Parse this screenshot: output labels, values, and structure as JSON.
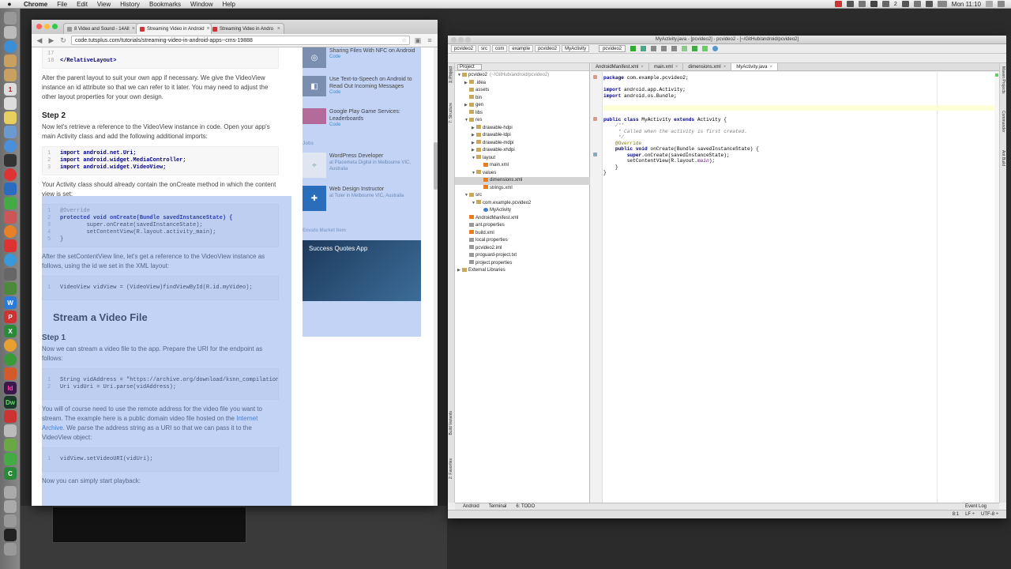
{
  "menubar": {
    "apple": "",
    "app": "Chrome",
    "items": [
      "File",
      "Edit",
      "View",
      "History",
      "Bookmarks",
      "Window",
      "Help"
    ],
    "clock": "Mon 11:10",
    "battery": "2"
  },
  "chrome": {
    "tabs": [
      {
        "label": "8 Video and Sound - 14All",
        "close": "×"
      },
      {
        "label": "Streaming Video in Android",
        "close": "×"
      },
      {
        "label": "Streaming Video in Andro",
        "close": "×"
      }
    ],
    "url": "code.tutsplus.com/tutorials/streaming-video-in-android-apps--cms-19888",
    "article": {
      "code0_line17": "17",
      "code0_line18": "18",
      "code0_text": "</RelativeLayout>",
      "p1": "Alter the parent layout to suit your own app if necessary. We give the VideoView instance an id attribute so that we can refer to it later. You may need to adjust the other layout properties for your own design.",
      "step2": "Step 2",
      "p2": "Now let's retrieve a reference to the VideoView instance in code. Open your app's main Activity class and add the following additional imports:",
      "imports": [
        "import android.net.Uri;",
        "import android.widget.MediaController;",
        "import android.widget.VideoView;"
      ],
      "p3": "Your Activity class should already contain the onCreate method in which the content view is set:",
      "oncreate": [
        "@Override",
        "protected void onCreate(Bundle savedInstanceState) {",
        "        super.onCreate(savedInstanceState);",
        "        setContentView(R.layout.activity_main);",
        "}"
      ],
      "p4": "After the setContentView line, let's get a reference to the VideoView instance as follows, using the id we set in the XML layout:",
      "findview": "VideoView vidView = (VideoView)findViewById(R.id.myVideo);",
      "h_stream": "Stream a Video File",
      "step1": "Step 1",
      "p5": "Now we can stream a video file to the app. Prepare the URI for the endpoint as follows:",
      "uri_lines": [
        "String vidAddress = \"https://archive.org/download/ksnn_compilation",
        "Uri vidUri = Uri.parse(vidAddress);"
      ],
      "p6a": "You will of course need to use the remote address for the video file you want to stream. The example here is a public domain video file hosted on the ",
      "p6link": "Internet Archive",
      "p6b": ". We parse the address string as a URI so that we can pass it to the VideoView object:",
      "seturi": "vidView.setVideoURI(vidUri);",
      "p7": "Now you can simply start playback:"
    },
    "sidebar": {
      "items": [
        {
          "title": "Sharing Files With NFC on Android",
          "tag": "Code"
        },
        {
          "title": "Use Text-to-Speech on Android to Read Out Incoming Messages",
          "tag": "Code"
        },
        {
          "title": "Google Play Game Services: Leaderboards",
          "tag": "Code"
        }
      ],
      "jobs_head": "Jobs",
      "jobs": [
        {
          "title": "WordPress Developer",
          "sub": "at Placemeta Digital in Melbourne VIC, Australia"
        },
        {
          "title": "Web Design Instructor",
          "sub": "at Tuler in Melbourne VIC, Australia"
        }
      ],
      "market_head": "Envato Market Item",
      "market_title": "Success Quotes App"
    }
  },
  "ide": {
    "title": "MyActivity.java - [pcvideo2] - pcvideo2 - [~/GitHub/android/pcvideo2]",
    "breadcrumbs": [
      "pcvideo2",
      "src",
      "com",
      "example",
      "pcvideo2",
      "MyActivity"
    ],
    "run_config": "pcvideo2",
    "project_select": "Project",
    "tree": [
      {
        "label": "pcvideo2",
        "sub": "(~/GitHub/android/pcvideo2)",
        "indent": 0,
        "arrow": "▼",
        "icon": "folder"
      },
      {
        "label": ".idea",
        "indent": 1,
        "arrow": "▶",
        "icon": "folder"
      },
      {
        "label": "assets",
        "indent": 1,
        "arrow": "",
        "icon": "folder"
      },
      {
        "label": "bin",
        "indent": 1,
        "arrow": "",
        "icon": "folder"
      },
      {
        "label": "gen",
        "indent": 1,
        "arrow": "▶",
        "icon": "folder"
      },
      {
        "label": "libs",
        "indent": 1,
        "arrow": "",
        "icon": "folder"
      },
      {
        "label": "res",
        "indent": 1,
        "arrow": "▼",
        "icon": "folder"
      },
      {
        "label": "drawable-hdpi",
        "indent": 2,
        "arrow": "▶",
        "icon": "folder"
      },
      {
        "label": "drawable-ldpi",
        "indent": 2,
        "arrow": "▶",
        "icon": "folder"
      },
      {
        "label": "drawable-mdpi",
        "indent": 2,
        "arrow": "▶",
        "icon": "folder"
      },
      {
        "label": "drawable-xhdpi",
        "indent": 2,
        "arrow": "▶",
        "icon": "folder"
      },
      {
        "label": "layout",
        "indent": 2,
        "arrow": "▼",
        "icon": "folder"
      },
      {
        "label": "main.xml",
        "indent": 3,
        "arrow": "",
        "icon": "file-x"
      },
      {
        "label": "values",
        "indent": 2,
        "arrow": "▼",
        "icon": "folder"
      },
      {
        "label": "dimensions.xml",
        "indent": 3,
        "arrow": "",
        "icon": "file-x",
        "selected": true
      },
      {
        "label": "strings.xml",
        "indent": 3,
        "arrow": "",
        "icon": "file-x"
      },
      {
        "label": "src",
        "indent": 1,
        "arrow": "▼",
        "icon": "folder"
      },
      {
        "label": "com.example.pcvideo2",
        "indent": 2,
        "arrow": "▼",
        "icon": "folder"
      },
      {
        "label": "MyActivity",
        "indent": 3,
        "arrow": "",
        "icon": "file-c"
      },
      {
        "label": "AndroidManifest.xml",
        "indent": 1,
        "arrow": "",
        "icon": "file-x"
      },
      {
        "label": "ant.properties",
        "indent": 1,
        "arrow": "",
        "icon": "file-g"
      },
      {
        "label": "build.xml",
        "indent": 1,
        "arrow": "",
        "icon": "file-x"
      },
      {
        "label": "local.properties",
        "indent": 1,
        "arrow": "",
        "icon": "file-g"
      },
      {
        "label": "pcvideo2.iml",
        "indent": 1,
        "arrow": "",
        "icon": "file-g"
      },
      {
        "label": "proguard-project.txt",
        "indent": 1,
        "arrow": "",
        "icon": "file-g"
      },
      {
        "label": "project.properties",
        "indent": 1,
        "arrow": "",
        "icon": "file-g"
      },
      {
        "label": "External Libraries",
        "indent": 0,
        "arrow": "▶",
        "icon": "folder"
      }
    ],
    "editor_tabs": [
      {
        "label": "AndroidManifest.xml",
        "close": "×"
      },
      {
        "label": "main.xml",
        "close": "×"
      },
      {
        "label": "dimensions.xml",
        "close": "×"
      },
      {
        "label": "MyActivity.java",
        "close": "×",
        "active": true
      }
    ],
    "code": {
      "pkg_kw": "package",
      "pkg": " com.example.pcvideo2;",
      "imp1_kw": "import",
      "imp1": " android.app.Activity;",
      "imp2_kw": "import",
      "imp2": " android.os.Bundle;",
      "cls_kw": "public class",
      "cls": " MyActivity ",
      "ext_kw": "extends",
      "cls_end": " Activity {",
      "jd1": "    /**",
      "jd2": "     * Called when the activity is first created.",
      "jd3": "     */",
      "ann": "    @Override",
      "m_kw": "    public void",
      "m": " onCreate(Bundle savedInstanceState) {",
      "super_kw": "        super",
      "super": ".onCreate(savedInstanceState);",
      "scv": "        setContentView(R.layout.",
      "scv_it": "main",
      "scv_end": ");",
      "close1": "    }",
      "close2": "}"
    },
    "left_strip": [
      "1: Project",
      "7: Structure",
      "Build Variants",
      "2: Favorites"
    ],
    "right_strip": [
      "Maven Projects",
      "Commander",
      "Ant Build"
    ],
    "bottom_tabs": [
      "Android",
      "Terminal",
      "6: TODO"
    ],
    "event_log": "Event Log",
    "status": {
      "pos": "8:1",
      "lf": "LF ÷",
      "enc": "UTF-8 ÷"
    }
  }
}
